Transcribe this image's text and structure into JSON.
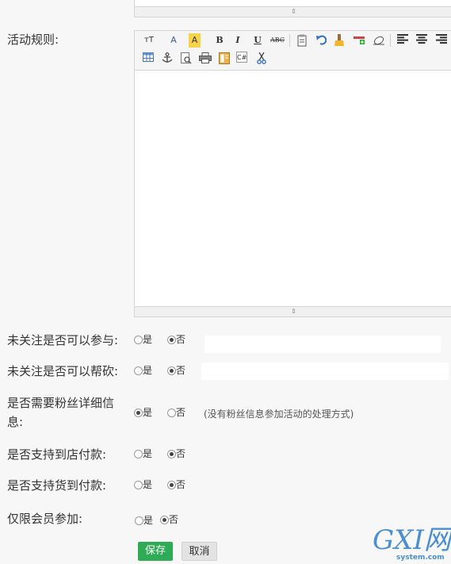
{
  "editor": {
    "label": "活动规则:",
    "toolbar": {
      "row1": [
        {
          "icon": "font-size-icon",
          "text": "тT"
        },
        {
          "icon": "font-color-icon",
          "text": "A"
        },
        {
          "icon": "highlight-color-icon",
          "text": "A"
        },
        {
          "icon": "bold-icon",
          "text": "B"
        },
        {
          "icon": "italic-icon",
          "text": "I"
        },
        {
          "icon": "underline-icon",
          "text": "U"
        },
        {
          "icon": "strikethrough-icon",
          "text": "ABC"
        },
        {
          "icon": "paste-icon",
          "text": ""
        },
        {
          "icon": "undo-icon",
          "text": ""
        },
        {
          "icon": "format-brush-icon",
          "text": ""
        },
        {
          "icon": "insert-row-icon",
          "text": ""
        },
        {
          "icon": "eraser-icon",
          "text": ""
        },
        {
          "icon": "align-left-icon",
          "text": ""
        },
        {
          "icon": "align-center-icon",
          "text": ""
        },
        {
          "icon": "align-right-icon",
          "text": ""
        }
      ],
      "row2": [
        {
          "icon": "table-icon",
          "text": ""
        },
        {
          "icon": "anchor-icon",
          "text": ""
        },
        {
          "icon": "preview-icon",
          "text": ""
        },
        {
          "icon": "print-icon",
          "text": ""
        },
        {
          "icon": "template-icon",
          "text": ""
        },
        {
          "icon": "code-icon",
          "text": "C#"
        },
        {
          "icon": "cut-icon",
          "text": ""
        }
      ]
    },
    "resize_glyph": "⇕"
  },
  "settings": [
    {
      "label": "未关注是否可以参与:",
      "options": [
        "是",
        "否"
      ],
      "selected": "否"
    },
    {
      "label": "未关注是否可以帮砍:",
      "options": [
        "是",
        "否"
      ],
      "selected": "否"
    },
    {
      "label_line1": "是否需要粉丝详细信",
      "label_line2": "息:",
      "options": [
        "是",
        "否"
      ],
      "selected": "是",
      "note": "(没有粉丝信息参加活动的处理方式)"
    },
    {
      "label": "是否支持到店付款:",
      "options": [
        "是",
        "否"
      ],
      "selected": "否"
    },
    {
      "label": "是否支持货到付款:",
      "options": [
        "是",
        "否"
      ],
      "selected": "否"
    },
    {
      "label": "仅限会员参加:",
      "options": [
        "是",
        "否"
      ],
      "selected": "否"
    }
  ],
  "buttons": {
    "save": "保存",
    "cancel": "取消"
  },
  "watermark": {
    "brand": "GXI网",
    "site": "system.com"
  },
  "colors": {
    "save_bg": "#2eac55",
    "page_bg": "#f7f7f7"
  }
}
